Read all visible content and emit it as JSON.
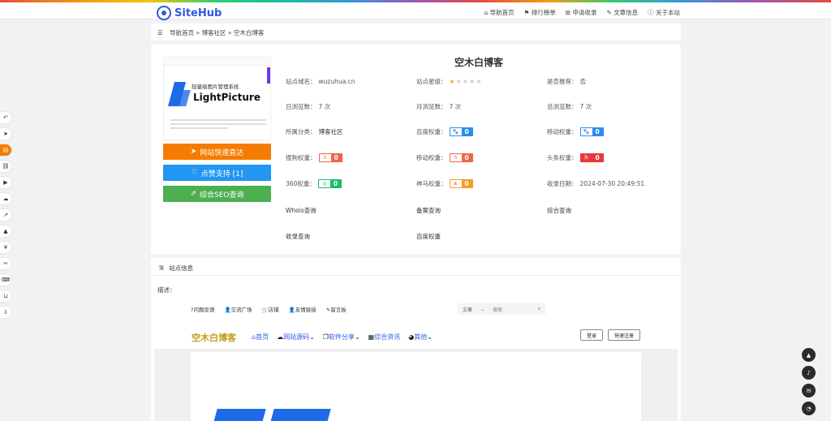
{
  "app": {
    "logo_text": "SiteHub"
  },
  "nav": {
    "items": [
      "导航首页",
      "排行榜单",
      "申请收录",
      "文章信息",
      "关于本站"
    ],
    "icons": [
      "home-icon",
      "flag-icon",
      "plus-square-icon",
      "book-icon",
      "info-icon"
    ]
  },
  "breadcrumb": {
    "home": "导航首页",
    "sep": "»",
    "category": "博客社区",
    "current": "空木白博客"
  },
  "thumb": {
    "subtitle": "轻量级图片管理系统",
    "brand": "LightPicture"
  },
  "buttons": {
    "visit": "网站快速直达",
    "like": "点赞支持 [1]",
    "seo": "综合SEO查询"
  },
  "site": {
    "title": "空木白博客",
    "domain_label": "站点域名：",
    "domain": "wuzuhua.cn",
    "stars_label": "站点星级：",
    "stars": 1,
    "stars_max": 5,
    "recommend_label": "是否推荐：",
    "recommend": "否",
    "daily_label": "日浏览数：",
    "daily": "7 次",
    "monthly_label": "月浏览数：",
    "monthly": "7 次",
    "total_label": "总浏览数：",
    "total": "7 次",
    "category_label": "所属分类：",
    "category": "博客社区",
    "baidu_label": "百度权重：",
    "baidu": "0",
    "mobile_label": "移动权重：",
    "mobile": "0",
    "sogou_label": "搜狗权重：",
    "sogou": "0",
    "mobile2_label": "移动权重：",
    "mobile2": "0",
    "toutiao_label": "头条权重：",
    "toutiao": "0",
    "s360_label": "360权重：",
    "s360": "0",
    "shenma_label": "神马权重：",
    "shenma": "0",
    "date_label": "收录日期：",
    "date": "2024-07-30 20:49:51",
    "whois": "Whois查询",
    "beian": "备案查询",
    "zonghe": "综合查询",
    "shoulu": "收录查询",
    "baiduq": "百度权重"
  },
  "colors": {
    "blue": "#2d8cf0",
    "orange_red": "#f06543",
    "red": "#e5383b",
    "green": "#19be6b",
    "amber": "#f59a23"
  },
  "section": {
    "title": "站点信息",
    "desc_label": "描述："
  },
  "preview": {
    "top_links": [
      "?问题反馈",
      "交流广场",
      "店铺",
      "友情链接",
      "留言板"
    ],
    "search_select": "文章",
    "search_placeholder": "搜索",
    "logo": "空木白博客",
    "nav": [
      "首页",
      "网站源码",
      "软件分享",
      "综合资讯",
      "其他"
    ],
    "login": "登录",
    "register": "快速注册"
  },
  "left_rail": [
    "back-icon",
    "send-icon",
    "file-icon",
    "link-icon",
    "play-icon",
    "cloud-icon",
    "chart-icon",
    "graduation-icon",
    "yen-icon",
    "wrench-icon",
    "keyboard-icon",
    "cart-icon",
    "download-icon"
  ],
  "right_rail": [
    "arrow-up-icon",
    "bell-icon",
    "mail-icon",
    "wechat-icon"
  ]
}
